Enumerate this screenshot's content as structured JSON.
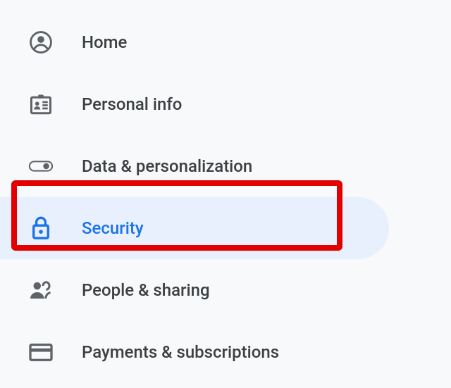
{
  "nav": {
    "items": [
      {
        "label": "Home"
      },
      {
        "label": "Personal info"
      },
      {
        "label": "Data & personalization"
      },
      {
        "label": "Security"
      },
      {
        "label": "People & sharing"
      },
      {
        "label": "Payments & subscriptions"
      }
    ],
    "selected_index": 3
  },
  "colors": {
    "icon_default": "#5f6368",
    "icon_selected": "#1a73e8",
    "text_default": "#3c4043",
    "text_selected": "#1a73e8",
    "selected_bg": "#e8f0fe",
    "highlight_border": "#e30000"
  }
}
